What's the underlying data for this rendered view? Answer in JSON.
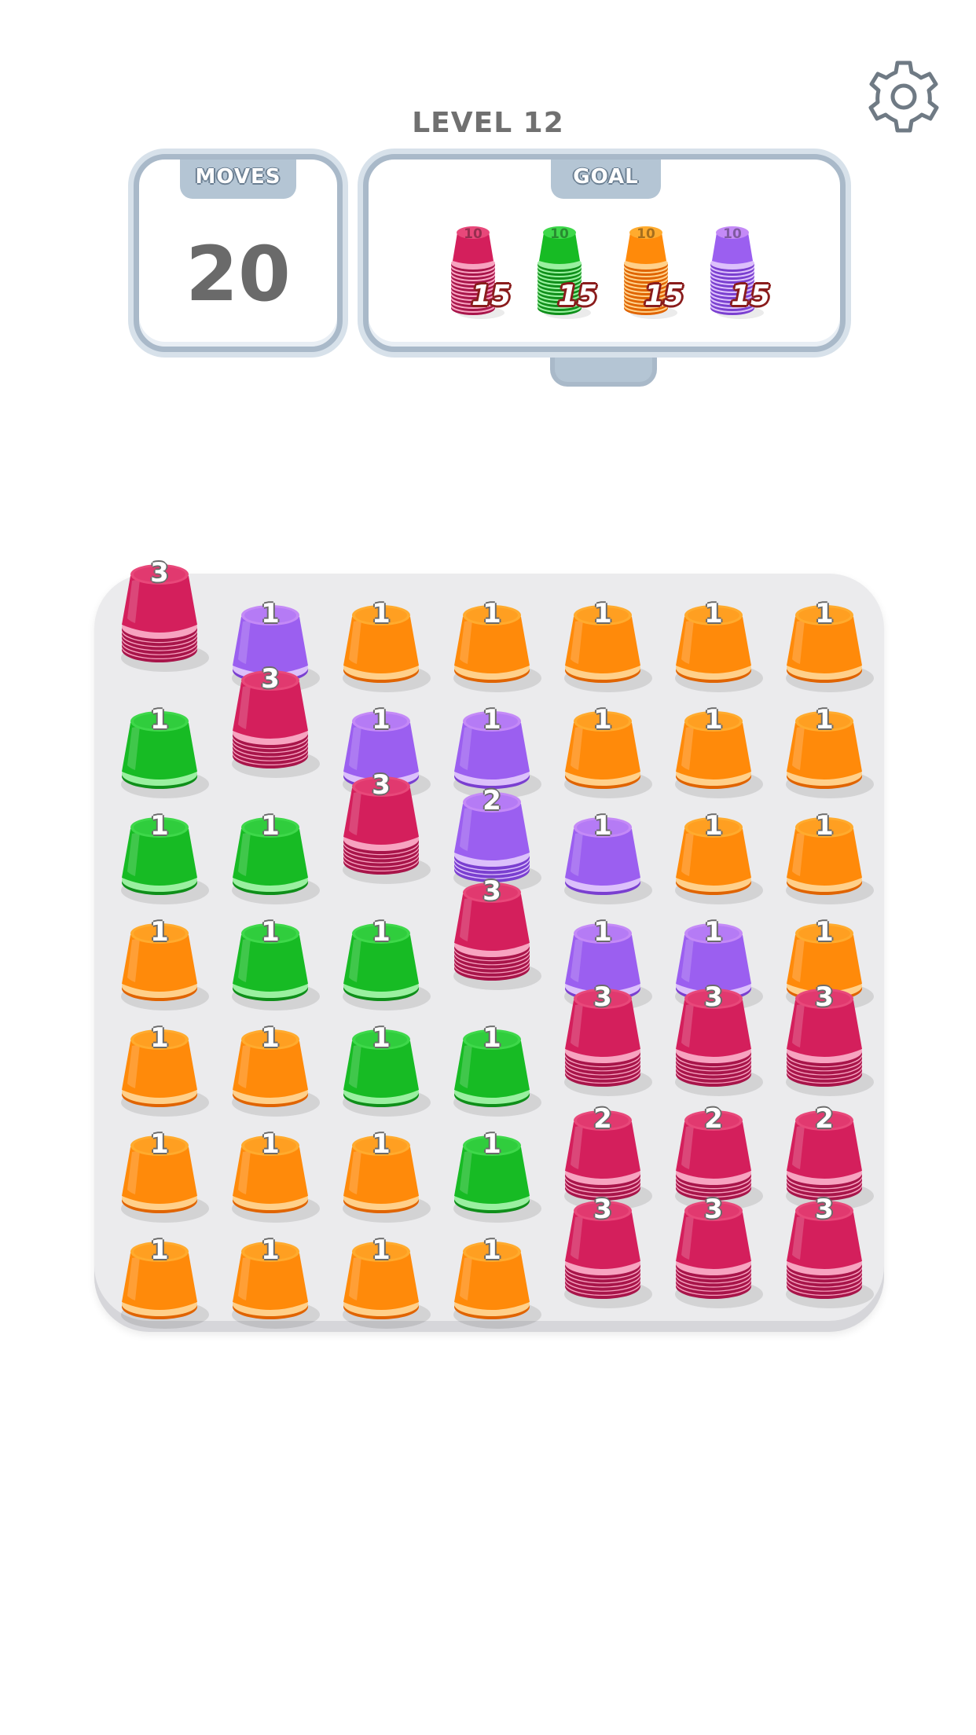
{
  "header": {
    "level_label": "LEVEL 12"
  },
  "moves": {
    "label": "MOVES",
    "value": "20"
  },
  "goal": {
    "label": "GOAL",
    "items": [
      {
        "color": "pink",
        "inner_label": "10",
        "count": "15"
      },
      {
        "color": "green",
        "inner_label": "10",
        "count": "15"
      },
      {
        "color": "orange",
        "inner_label": "10",
        "count": "15"
      },
      {
        "color": "purple",
        "inner_label": "10",
        "count": "15"
      }
    ]
  },
  "icons": {
    "settings": "gear-icon"
  },
  "colors": {
    "pink": {
      "top": "#e8487a",
      "body": "#d41f5c",
      "rim": "#f7a3c0",
      "dark": "#a8154a"
    },
    "purple": {
      "top": "#c48af7",
      "body": "#9b5ff0",
      "rim": "#dcc0fb",
      "dark": "#7a3fd0"
    },
    "orange": {
      "top": "#ffab2e",
      "body": "#ff8a0a",
      "rim": "#ffd08a",
      "dark": "#e06400"
    },
    "green": {
      "top": "#3ed84a",
      "body": "#17bb24",
      "rim": "#9af0a0",
      "dark": "#0f8f1a"
    }
  },
  "board": [
    [
      {
        "c": "pink",
        "n": "3"
      },
      {
        "c": "purple",
        "n": "1"
      },
      {
        "c": "orange",
        "n": "1"
      },
      {
        "c": "orange",
        "n": "1"
      },
      {
        "c": "orange",
        "n": "1"
      },
      {
        "c": "orange",
        "n": "1"
      },
      {
        "c": "orange",
        "n": "1"
      }
    ],
    [
      {
        "c": "green",
        "n": "1"
      },
      {
        "c": "pink",
        "n": "3"
      },
      {
        "c": "purple",
        "n": "1"
      },
      {
        "c": "purple",
        "n": "1"
      },
      {
        "c": "orange",
        "n": "1"
      },
      {
        "c": "orange",
        "n": "1"
      },
      {
        "c": "orange",
        "n": "1"
      }
    ],
    [
      {
        "c": "green",
        "n": "1"
      },
      {
        "c": "green",
        "n": "1"
      },
      {
        "c": "pink",
        "n": "3"
      },
      {
        "c": "purple",
        "n": "2"
      },
      {
        "c": "purple",
        "n": "1"
      },
      {
        "c": "orange",
        "n": "1"
      },
      {
        "c": "orange",
        "n": "1"
      }
    ],
    [
      {
        "c": "orange",
        "n": "1"
      },
      {
        "c": "green",
        "n": "1"
      },
      {
        "c": "green",
        "n": "1"
      },
      {
        "c": "pink",
        "n": "3"
      },
      {
        "c": "purple",
        "n": "1"
      },
      {
        "c": "purple",
        "n": "1"
      },
      {
        "c": "orange",
        "n": "1"
      }
    ],
    [
      {
        "c": "orange",
        "n": "1"
      },
      {
        "c": "orange",
        "n": "1"
      },
      {
        "c": "green",
        "n": "1"
      },
      {
        "c": "green",
        "n": "1"
      },
      {
        "c": "pink",
        "n": "3"
      },
      {
        "c": "pink",
        "n": "3"
      },
      {
        "c": "pink",
        "n": "3"
      }
    ],
    [
      {
        "c": "orange",
        "n": "1"
      },
      {
        "c": "orange",
        "n": "1"
      },
      {
        "c": "orange",
        "n": "1"
      },
      {
        "c": "green",
        "n": "1"
      },
      {
        "c": "pink",
        "n": "2"
      },
      {
        "c": "pink",
        "n": "2"
      },
      {
        "c": "pink",
        "n": "2"
      }
    ],
    [
      {
        "c": "orange",
        "n": "1"
      },
      {
        "c": "orange",
        "n": "1"
      },
      {
        "c": "orange",
        "n": "1"
      },
      {
        "c": "orange",
        "n": "1"
      },
      {
        "c": "pink",
        "n": "3"
      },
      {
        "c": "pink",
        "n": "3"
      },
      {
        "c": "pink",
        "n": "3"
      }
    ]
  ]
}
